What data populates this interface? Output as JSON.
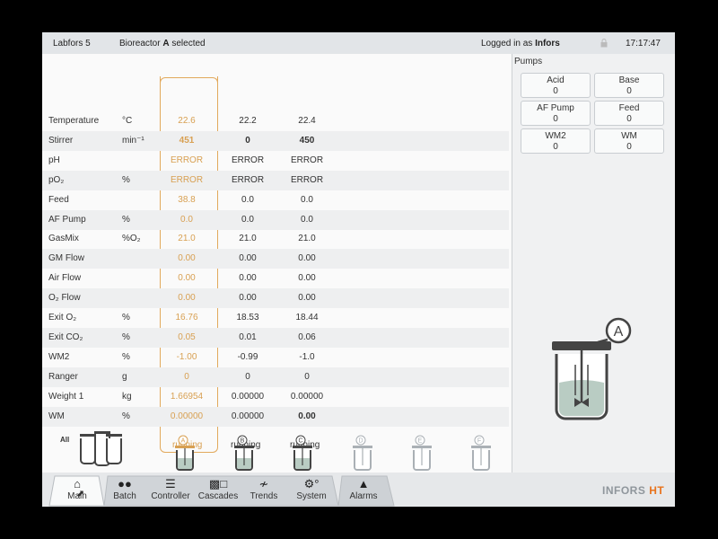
{
  "topbar": {
    "app": "Labfors 5",
    "bioreactor_prefix": "Bioreactor",
    "bioreactor_id": "A",
    "bioreactor_suffix": "selected",
    "login_prefix": "Logged in as",
    "user": "Infors",
    "time": "17:17:47"
  },
  "table": {
    "rows": [
      {
        "name": "Temperature",
        "unit": "°C",
        "a": "22.6",
        "b": "22.2",
        "c": "22.4"
      },
      {
        "name": "Stirrer",
        "unit": "min⁻¹",
        "a": "451",
        "b": "0",
        "c": "450"
      },
      {
        "name": "pH",
        "unit": "",
        "a": "ERROR",
        "b": "ERROR",
        "c": "ERROR"
      },
      {
        "name": "pO₂",
        "unit": "%",
        "a": "ERROR",
        "b": "ERROR",
        "c": "ERROR"
      },
      {
        "name": "Feed",
        "unit": "",
        "a": "38.8",
        "b": "0.0",
        "c": "0.0"
      },
      {
        "name": "AF Pump",
        "unit": "%",
        "a": "0.0",
        "b": "0.0",
        "c": "0.0"
      },
      {
        "name": "GasMix",
        "unit": "%O₂",
        "a": "21.0",
        "b": "21.0",
        "c": "21.0"
      },
      {
        "name": "GM Flow",
        "unit": "",
        "a": "0.00",
        "b": "0.00",
        "c": "0.00"
      },
      {
        "name": "Air Flow",
        "unit": "",
        "a": "0.00",
        "b": "0.00",
        "c": "0.00"
      },
      {
        "name": "O₂ Flow",
        "unit": "",
        "a": "0.00",
        "b": "0.00",
        "c": "0.00"
      },
      {
        "name": "Exit O₂",
        "unit": "%",
        "a": "16.76",
        "b": "18.53",
        "c": "18.44"
      },
      {
        "name": "Exit CO₂",
        "unit": "%",
        "a": "0.05",
        "b": "0.01",
        "c": "0.06"
      },
      {
        "name": "WM2",
        "unit": "%",
        "a": "-1.00",
        "b": "-0.99",
        "c": "-1.0"
      },
      {
        "name": "Ranger",
        "unit": "g",
        "a": "0",
        "b": "0",
        "c": "0"
      },
      {
        "name": "Weight 1",
        "unit": "kg",
        "a": "1.66954",
        "b": "0.00000",
        "c": "0.00000"
      },
      {
        "name": "WM",
        "unit": "%",
        "a": "0.00000",
        "b": "0.00000",
        "c": "0.00"
      }
    ],
    "status": [
      "running",
      "running",
      "running"
    ]
  },
  "vessels": {
    "all_label": "All",
    "ids": [
      "A",
      "B",
      "C",
      "D",
      "E",
      "F"
    ]
  },
  "pumps": {
    "title": "Pumps",
    "items": [
      {
        "label": "Acid",
        "value": "0"
      },
      {
        "label": "Base",
        "value": "0"
      },
      {
        "label": "AF Pump",
        "value": "0"
      },
      {
        "label": "Feed",
        "value": "0"
      },
      {
        "label": "WM2",
        "value": "0"
      },
      {
        "label": "WM",
        "value": "0"
      }
    ],
    "selected_reactor": "A"
  },
  "nav": {
    "tabs": [
      "Main",
      "Batch",
      "Controller",
      "Cascades",
      "Trends",
      "System",
      "Alarms"
    ],
    "brand_left": "INFORS",
    "brand_right": "HT"
  },
  "colors": {
    "accent": "#e2a95c",
    "brand": "#e8731c",
    "liquid": "#b9ccc3"
  }
}
